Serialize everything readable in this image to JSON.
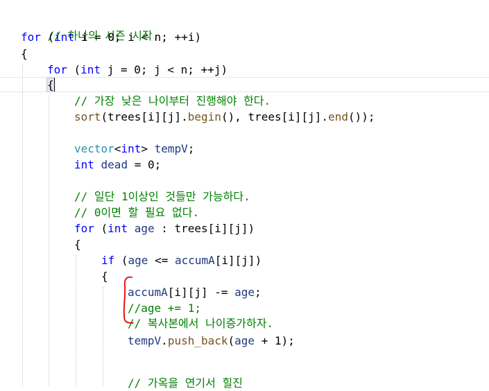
{
  "colors": {
    "keyword": "#0000ff",
    "comment": "#008000",
    "function": "#74531f",
    "type": "#2b91af",
    "variable": "#1f377f",
    "member": "#8a1bff",
    "annotation": "#e00000"
  },
  "code": {
    "l1": {
      "comment": "// 하나의 시즌 시작."
    },
    "l2": {
      "kw": "for",
      "p1": " (",
      "kw2": "int",
      "p2": " i = 0; i < n; ++i)"
    },
    "l3": {
      "text": "{"
    },
    "l4": {
      "kw": "for",
      "p1": " (",
      "kw2": "int",
      "p2": " j = 0; j < n; ++j)"
    },
    "l5": {
      "brace": "{"
    },
    "l6": {
      "comment": "// 가장 낮은 나이부터 진행해야 한다."
    },
    "l7": {
      "fn": "sort",
      "a": "(trees[i][j].",
      "m1": "begin",
      "b": "(), trees[i][j].",
      "m2": "end",
      "c": "());"
    },
    "l8": {
      "type": "vector",
      "a": "<",
      "kw": "int",
      "b": "> ",
      "var": "tempV",
      "c": ";"
    },
    "l9": {
      "kw": "int",
      "var": " dead",
      "rest": " = 0;"
    },
    "l10": {
      "comment": "// 일단 1이상인 것들만 가능하다."
    },
    "l11": {
      "comment": "// 0이면 할 필요 없다."
    },
    "l12": {
      "kw": "for",
      "a": " (",
      "kw2": "int",
      "var": " age",
      "b": " : trees[i][j])"
    },
    "l13": {
      "text": "{"
    },
    "l14": {
      "kw": "if",
      "a": " (",
      "v1": "age",
      "b": " <= ",
      "v2": "accumA",
      "c": "[i][j])"
    },
    "l15": {
      "text": "{"
    },
    "l16": {
      "v1": "accumA",
      "a": "[i][j] -= ",
      "v2": "age",
      "b": ";"
    },
    "l17": {
      "comment": "//age += 1;"
    },
    "l18": {
      "comment": "// 복사본에서 나이증가하자."
    },
    "l19": {
      "v1": "tempV",
      "a": ".",
      "m": "push_back",
      "b": "(",
      "v2": "age",
      "c": " + 1);"
    },
    "l20": {
      "comment": "// 가옥을 연기서 힐진"
    }
  }
}
